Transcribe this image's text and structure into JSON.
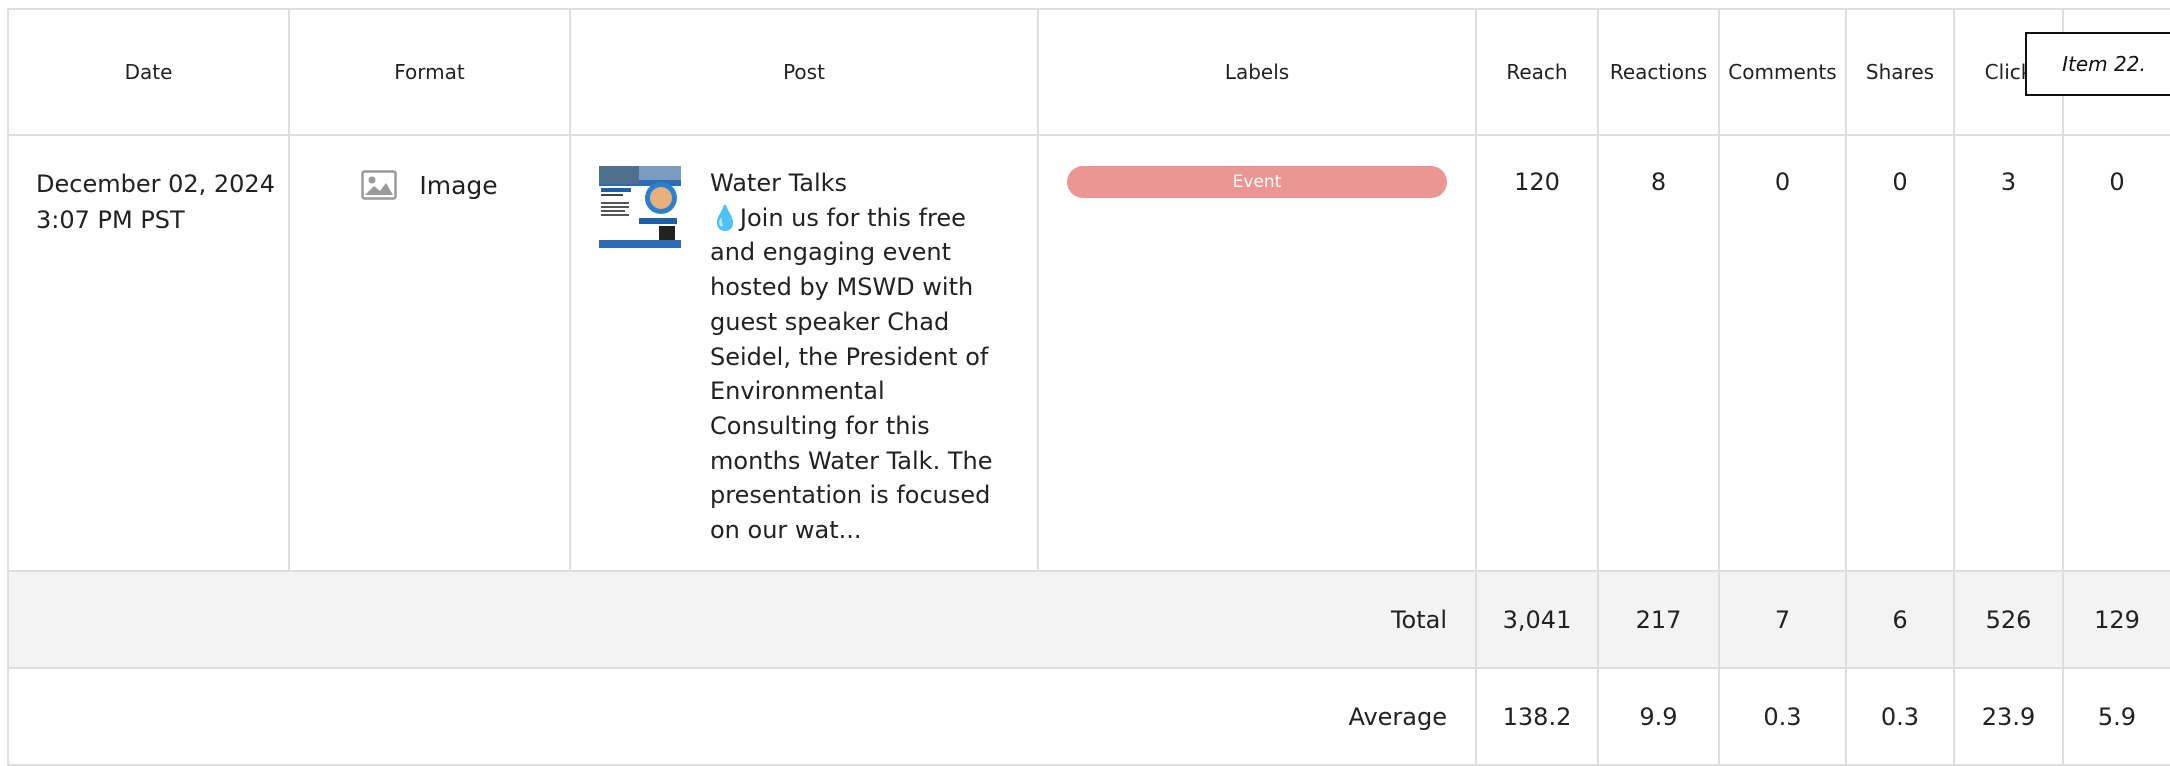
{
  "table": {
    "headers": {
      "date": "Date",
      "format": "Format",
      "post": "Post",
      "labels": "Labels",
      "reach": "Reach",
      "reactions": "Reactions",
      "comments": "Comments",
      "shares": "Shares",
      "clicks": "Click",
      "last": ""
    },
    "row": {
      "date": "December 02, 2024",
      "time": "3:07 PM PST",
      "format_icon": "image-icon",
      "format": "Image",
      "post_title": "Water Talks",
      "post_body": "💧Join us for this free and engaging event hosted by MSWD with guest speaker Chad Seidel, the President of Environmental Consulting for this months Water Talk. The presentation is focused on our wat...",
      "label": "Event",
      "label_color": "#ec9694",
      "reach": "120",
      "reactions": "8",
      "comments": "0",
      "shares": "0",
      "clicks": "3",
      "last": "0"
    },
    "total": {
      "label": "Total",
      "reach": "3,041",
      "reactions": "217",
      "comments": "7",
      "shares": "6",
      "clicks": "526",
      "last": "129"
    },
    "average": {
      "label": "Average",
      "reach": "138.2",
      "reactions": "9.9",
      "comments": "0.3",
      "shares": "0.3",
      "clicks": "23.9",
      "last": "5.9"
    }
  },
  "tooltip": {
    "text": "Item 22."
  }
}
